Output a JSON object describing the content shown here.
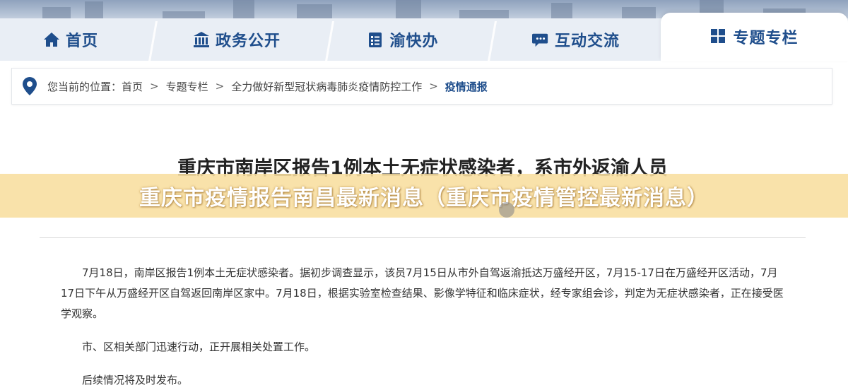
{
  "nav": {
    "tabs": [
      {
        "label": "首页",
        "icon": "home-icon"
      },
      {
        "label": "政务公开",
        "icon": "government-building-icon"
      },
      {
        "label": "渝快办",
        "icon": "clipboard-icon"
      },
      {
        "label": "互动交流",
        "icon": "chat-bubble-icon"
      },
      {
        "label": "专题专栏",
        "icon": "grid-icon",
        "active": true
      }
    ]
  },
  "breadcrumb": {
    "prefix": "您当前的位置：",
    "items": [
      "首页",
      "专题专栏",
      "全力做好新型冠状病毒肺炎疫情防控工作",
      "疫情通报"
    ],
    "separator": ">"
  },
  "article": {
    "title": "重庆市南岸区报告1例本土无症状感染者，系市外返渝人员",
    "paragraphs": [
      "7月18日，南岸区报告1例本土无症状感染者。据初步调查显示，该员7月15日从市外自驾返渝抵达万盛经开区，7月15-17日在万盛经开区活动，7月17日下午从万盛经开区自驾返回南岸区家中。7月18日，根据实验室检查结果、影像学特征和临床症状，经专家组会诊，判定为无症状感染者，正在接受医学观察。",
      "市、区相关部门迅速行动，正开展相关处置工作。",
      "后续情况将及时发布。"
    ]
  },
  "overlay": {
    "headline": "重庆市疫情报告南昌最新消息（重庆市疫情管控最新消息）"
  },
  "colors": {
    "accent": "#1f4e8c",
    "overlay_bg": "#f8de9e"
  }
}
